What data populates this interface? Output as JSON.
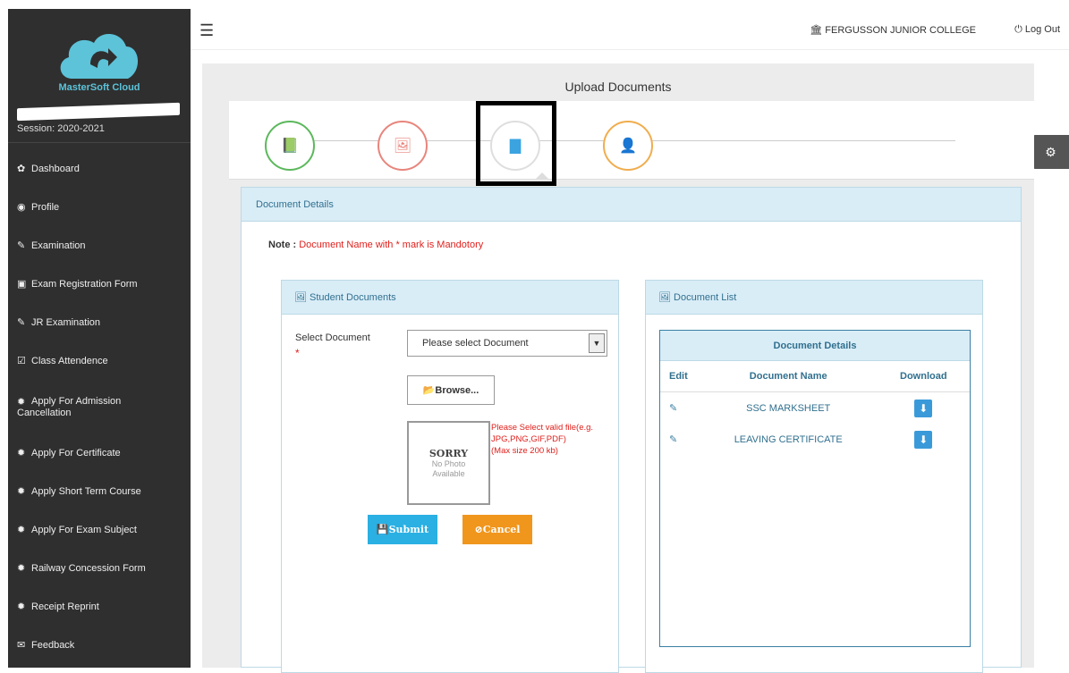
{
  "brand": {
    "name": "MasterSoft Cloud",
    "session": "Session: 2020-2021"
  },
  "sidebar": {
    "items": [
      {
        "label": "Dashboard",
        "icon": "dashboard-icon",
        "glyph": "✿"
      },
      {
        "label": "Profile",
        "icon": "user-circle-icon",
        "glyph": "◉"
      },
      {
        "label": "Examination",
        "icon": "pencil-icon",
        "glyph": "✎"
      },
      {
        "label": "Exam Registration Form",
        "icon": "file-pdf-icon",
        "glyph": "▣"
      },
      {
        "label": "JR Examination",
        "icon": "pencil-icon",
        "glyph": "✎"
      },
      {
        "label": "Class Attendence",
        "icon": "checkbox-icon",
        "glyph": "☑"
      },
      {
        "label": "Apply For Admission",
        "label2": "Cancellation",
        "icon": "certificate-icon",
        "glyph": "✹"
      },
      {
        "label": "Apply For Certificate",
        "icon": "certificate-icon",
        "glyph": "✹"
      },
      {
        "label": "Apply Short Term Course",
        "icon": "certificate-icon",
        "glyph": "✹"
      },
      {
        "label": "Apply For Exam Subject",
        "icon": "certificate-icon",
        "glyph": "✹"
      },
      {
        "label": "Railway Concession Form",
        "icon": "certificate-icon",
        "glyph": "✹"
      },
      {
        "label": "Receipt Reprint",
        "icon": "certificate-icon",
        "glyph": "✹"
      },
      {
        "label": "Feedback",
        "icon": "comments-icon",
        "glyph": "✉"
      }
    ]
  },
  "header": {
    "college": "FERGUSSON JUNIOR COLLEGE",
    "logout": "Log Out"
  },
  "page": {
    "title": "Upload Documents"
  },
  "panel": {
    "title": "Document Details",
    "note_label": "Note :",
    "note_text": "Document Name with * mark is Mandotory"
  },
  "student_docs": {
    "title": "Student Documents",
    "select_label": "Select Document",
    "required_mark": "*",
    "select_value": "Please select Document",
    "browse_label": "Browse...",
    "photo_sorry": "SORRY",
    "photo_line1": "No Photo",
    "photo_line2": "Available",
    "hint_line1": "Please Select valid file(e.g.",
    "hint_line2": "JPG,PNG,GIF,PDF)",
    "hint_line3": "(Max size 200 kb)",
    "submit_label": "Submit",
    "cancel_label": "Cancel"
  },
  "doc_list": {
    "title": "Document List",
    "table_title": "Document Details",
    "columns": [
      "Edit",
      "Document Name",
      "Download"
    ],
    "rows": [
      {
        "name": "SSC MARKSHEET"
      },
      {
        "name": "LEAVING CERTIFICATE"
      }
    ]
  },
  "colors": {
    "sidebar": "#2f2f2f",
    "brand": "#5cc3d9",
    "panel_head": "#d9edf7",
    "required": "#e0201c",
    "submit": "#2ab0e3",
    "cancel": "#f0961d"
  }
}
